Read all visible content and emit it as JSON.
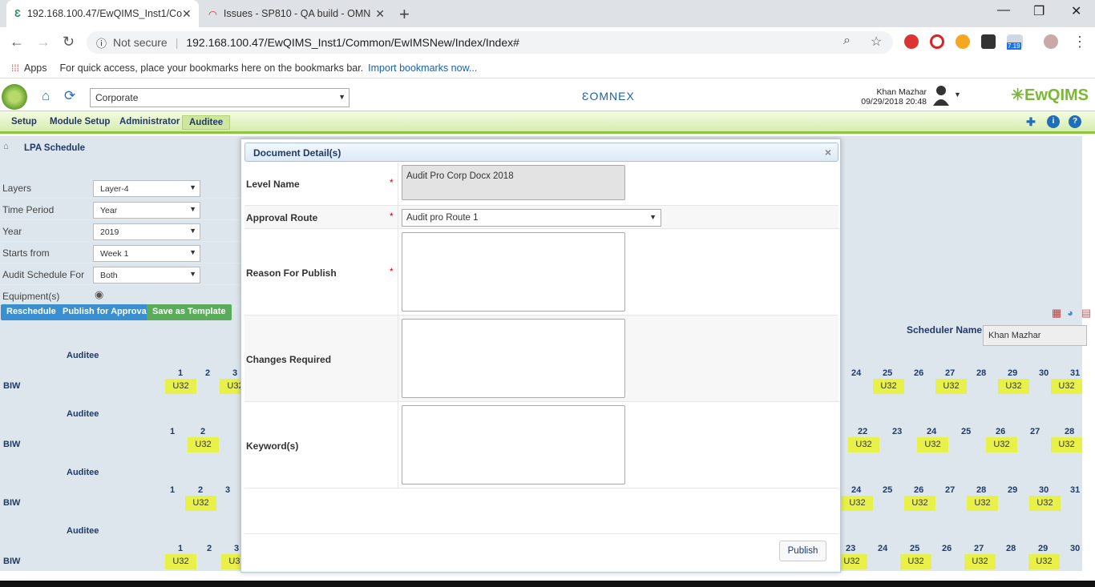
{
  "browser": {
    "tabs": [
      {
        "title": "192.168.100.47/EwQIMS_Inst1/Co"
      },
      {
        "title": "Issues - SP810 - QA build - OMN"
      }
    ],
    "not_secure": "Not secure",
    "url": "192.168.100.47/EwQIMS_Inst1/Common/EwIMSNew/Index/Index#",
    "ext_badge": "7.19",
    "bookmarks_apps": "Apps",
    "bookmarks_hint": "For quick access, place your bookmarks here on the bookmarks bar.",
    "bookmarks_import": "Import bookmarks now..."
  },
  "header": {
    "org_select": "Corporate",
    "brand_center": "OMNEX",
    "user_name": "Khan Mazhar",
    "datetime": "09/29/2018 20:48",
    "brand_right": "EwQIMS"
  },
  "menu": [
    "Setup",
    "Module Setup",
    "Administrator",
    "Auditee"
  ],
  "page": {
    "breadcrumb": "LPA Schedule",
    "filters": [
      {
        "label": "Layers",
        "value": "Layer-4"
      },
      {
        "label": "Time Period",
        "value": "Year"
      },
      {
        "label": "Year",
        "value": "2019"
      },
      {
        "label": "Starts from",
        "value": "Week 1"
      },
      {
        "label": "Audit Schedule For",
        "value": "Both"
      },
      {
        "label": "Equipment(s)",
        "value": ""
      }
    ],
    "buttons": {
      "reschedule": "Reschedule",
      "publish": "Publish for Approval",
      "template": "Save as Template"
    },
    "scheduler_label": "Scheduler Name",
    "scheduler_value": "Khan  Mazhar",
    "auditee_label": "Auditee",
    "row_label": "BIW",
    "cell_value": "U32",
    "groups": [
      {
        "left_days": [
          "1",
          "2",
          "3"
        ],
        "right_days": [
          "24",
          "25",
          "26",
          "27",
          "28",
          "29",
          "30",
          "31"
        ]
      },
      {
        "left_days": [
          "1",
          "2"
        ],
        "right_days": [
          "22",
          "23",
          "24",
          "25",
          "26",
          "27",
          "28"
        ]
      },
      {
        "left_days": [
          "1",
          "2",
          "3"
        ],
        "right_days": [
          "24",
          "25",
          "26",
          "27",
          "28",
          "29",
          "30",
          "31"
        ]
      },
      {
        "left_days": [
          "1",
          "2",
          "3"
        ],
        "right_days": [
          "23",
          "24",
          "25",
          "26",
          "27",
          "28",
          "29",
          "30"
        ]
      }
    ]
  },
  "modal": {
    "title": "Document Detail(s)",
    "close": "×",
    "fields": {
      "level_name_label": "Level Name",
      "level_name_value": "Audit Pro Corp Docx 2018",
      "approval_route_label": "Approval Route",
      "approval_route_value": "Audit pro Route 1",
      "reason_label": "Reason For Publish",
      "changes_label": "Changes Required",
      "keywords_label": "Keyword(s)",
      "required_mark": "*"
    },
    "publish_button": "Publish"
  }
}
